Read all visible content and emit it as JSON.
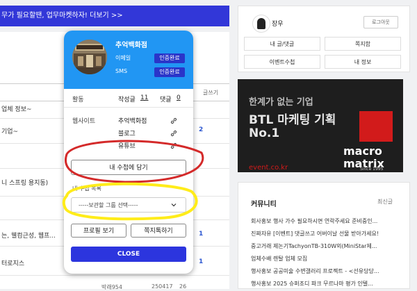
{
  "banner": {
    "text": "무가 필요할땐, 업무마켓하자! 더보기 >>"
  },
  "left_list": {
    "rows": [
      "업체 정보~",
      "기업~",
      "니 스프링 용지동)",
      "는, 웰컴근성, 웹프...",
      "터로지스"
    ],
    "numbers": [
      "2",
      "1",
      "1"
    ],
    "header_snip": "글쓰기",
    "bottom_author": "박래954",
    "bottom_date": "250417",
    "bottom_count": "26"
  },
  "profile": {
    "name": "장우",
    "logout_label": "로그아웃",
    "buttons": [
      "내 글/댓글",
      "쪽지함",
      "이벤트수첩",
      "내 정보"
    ]
  },
  "ad": {
    "line1": "한계가 없는 기업",
    "line2": "BTL 마케팅 기획",
    "line3": "No.1",
    "brand_line1": "macro",
    "brand_line2": "matrix",
    "since": "Since 1995",
    "url": "event.co.kr",
    "accent": "#d21b1b"
  },
  "community": {
    "title": "커뮤니티",
    "more": "최신글",
    "items": [
      "회사홍보 행사 가수 필요하시면 연락주세요 준비중인...",
      "진짜자유 [이벤트] 댓글쓰고 어버이날 선물 받아가세요!",
      "중고거래 제논기TachyonTB-310W외(MiniStar제...",
      "업체수배 렌탈 업체 모집",
      "행사홍보 공공미술 수변갤러리 프로젝트 - <선유당당...",
      "행사홍보 2025 슈퍼조디 파크 무르나마 평가 인텔..."
    ]
  },
  "popup": {
    "store_name": "추억백화점",
    "email_label": "이메일",
    "sms_label": "SMS",
    "verified_label": "인증완료",
    "activity_label": "활동",
    "posts_label": "작성글",
    "posts_count": "11",
    "comments_label": "댓글",
    "comments_count": "0",
    "website_label": "웹사이트",
    "sites": [
      "추억백화점",
      "블로그",
      "유튜브"
    ],
    "collect_label": "내 수첩에 담기",
    "group_section_label": "내 수첩 목록",
    "group_select_value": "-----보관할 그룹 선택-----",
    "profile_button": "프로필 보기",
    "message_button": "쪽지톡하기",
    "close_button": "CLOSE",
    "accent": "#2196f3",
    "close_color": "#2c35de"
  },
  "annotations": {
    "red_ellipse_color": "#d42a2a",
    "yellow_ellipse_color": "#ffec1a"
  }
}
